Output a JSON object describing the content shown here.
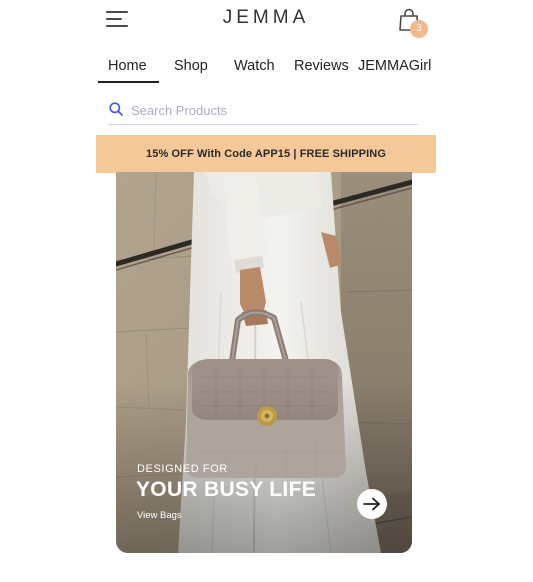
{
  "header": {
    "logo": "JEMMA",
    "cart_count": "3",
    "menu_icon": "hamburger-menu-icon",
    "cart_icon": "shopping-bag-icon"
  },
  "nav": {
    "tabs": [
      {
        "label": "Home",
        "active": true
      },
      {
        "label": "Shop",
        "active": false
      },
      {
        "label": "Watch",
        "active": false
      },
      {
        "label": "Reviews",
        "active": false
      },
      {
        "label": "JEMMAGirl",
        "active": false
      }
    ]
  },
  "search": {
    "placeholder": "Search Products",
    "value": "",
    "icon": "search-icon"
  },
  "promo": {
    "text": "15% OFF With Code APP15 | FREE SHIPPING"
  },
  "hero": {
    "overline": "DESIGNED FOR",
    "title": "YOUR BUSY LIFE",
    "link_label": "View Bags",
    "arrow_icon": "arrow-right-icon"
  },
  "colors": {
    "promo_background": "#f5c899",
    "cart_badge": "#f3b98a",
    "search_icon": "#4a5bd6",
    "text_primary": "#222222"
  }
}
